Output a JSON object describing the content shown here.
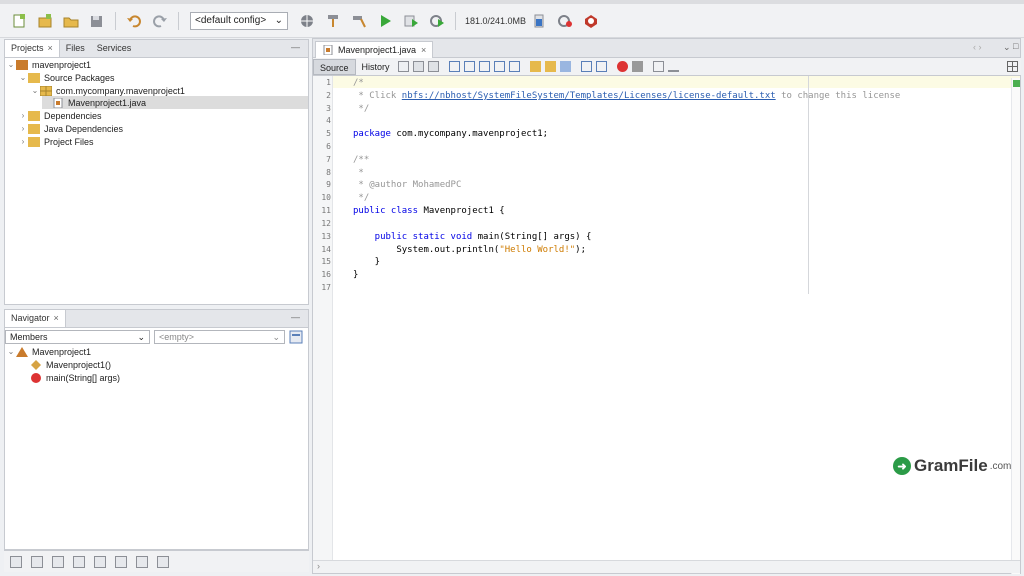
{
  "toolbar": {
    "config_value": "<default config>",
    "memory": "181.0/241.0MB"
  },
  "projects_panel": {
    "tabs": [
      "Projects",
      "Files",
      "Services"
    ],
    "tree": [
      {
        "label": "mavenproject1",
        "level": 0,
        "expanded": true
      },
      {
        "label": "Source Packages",
        "level": 1,
        "expanded": true
      },
      {
        "label": "com.mycompany.mavenproject1",
        "level": 2,
        "expanded": true
      },
      {
        "label": "Mavenproject1.java",
        "level": 3,
        "selected": true
      },
      {
        "label": "Dependencies",
        "level": 1,
        "expanded": false
      },
      {
        "label": "Java Dependencies",
        "level": 1,
        "expanded": false
      },
      {
        "label": "Project Files",
        "level": 1,
        "expanded": false
      }
    ]
  },
  "navigator_panel": {
    "tab": "Navigator",
    "members_select": "Members",
    "filter_select": "<empty>",
    "tree": [
      {
        "label": "Mavenproject1",
        "level": 0
      },
      {
        "label": "Mavenproject1()",
        "level": 1
      },
      {
        "label": "main(String[] args)",
        "level": 1
      }
    ]
  },
  "editor": {
    "tab_title": "Mavenproject1.java",
    "source_label": "Source",
    "history_label": "History",
    "line_numbers": [
      "1",
      "2",
      "3",
      "4",
      "5",
      "6",
      "7",
      "8",
      "9",
      "10",
      "11",
      "12",
      "13",
      "14",
      "15",
      "16",
      "17"
    ],
    "lines": {
      "l1": "/*",
      "l2_a": " * Click ",
      "l2_link": "nbfs://nbhost/SystemFileSystem/Templates/Licenses/license-default.txt",
      "l2_b": " to change this license",
      "l3": " */",
      "l5_kw": "package",
      "l5_rest": " com.mycompany.mavenproject1;",
      "l7": "/**",
      "l8": " *",
      "l9": " * @author MohamedPC",
      "l10": " */",
      "l11_kw": "public class",
      "l11_rest": " Mavenproject1 {",
      "l13_kw": "    public static void",
      "l13_rest": " main(String[] args) {",
      "l14_a": "        System.out.println(",
      "l14_str": "\"Hello World!\"",
      "l14_b": ");",
      "l15": "    }",
      "l16": "}"
    }
  },
  "watermark": {
    "brand": "GramFile",
    "suffix": ".com"
  }
}
